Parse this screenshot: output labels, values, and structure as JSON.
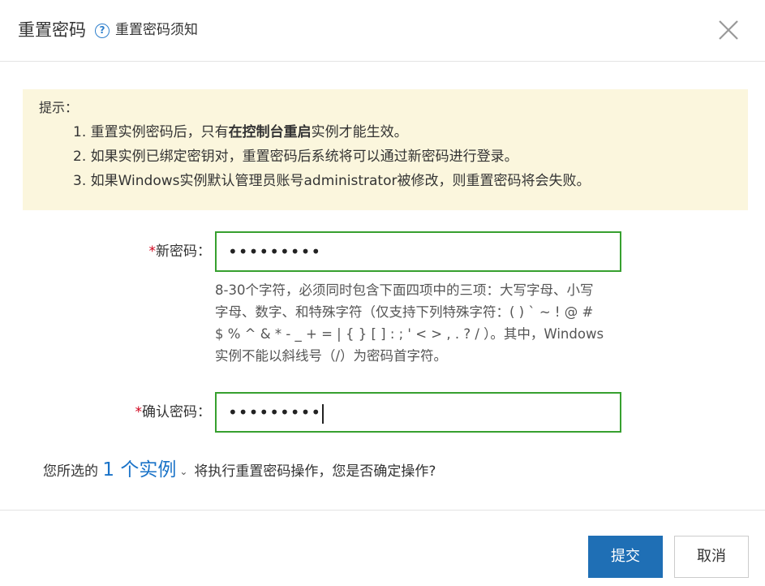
{
  "header": {
    "title": "重置密码",
    "help_link": "重置密码须知"
  },
  "notice": {
    "label": "提示：",
    "items": [
      {
        "prefix": "1. 重置实例密码后，只有",
        "bold": "在控制台重启",
        "suffix": "实例才能生效。"
      },
      {
        "text": "2. 如果实例已绑定密钥对，重置密码后系统将可以通过新密码进行登录。"
      },
      {
        "text": "3. 如果Windows实例默认管理员账号administrator被修改，则重置密码将会失败。"
      }
    ]
  },
  "form": {
    "required_mark": "*",
    "new_password": {
      "label": "新密码：",
      "value": "•••••••••"
    },
    "hint": "8-30个字符，必须同时包含下面四项中的三项：大写字母、小写字母、数字、和特殊字符（仅支持下列特殊字符：( ) ` ~ ! @ # $ % ^ & * - _ + = | { } [ ] : ; ' < > , . ? / ）。其中，Windows 实例不能以斜线号（/）为密码首字符。",
    "confirm_password": {
      "label": "确认密码：",
      "value": "•••••••••"
    }
  },
  "summary": {
    "prefix": "您所选的",
    "instance_link": "1 个实例",
    "suffix": "将执行重置密码操作，您是否确定操作?"
  },
  "footer": {
    "submit_label": "提交",
    "cancel_label": "取消"
  },
  "colors": {
    "accent": "#1f6fb5",
    "link": "#1a73c8",
    "input_border_valid": "#37a02f",
    "notice_bg": "#fbf6dd",
    "required": "#d0021b"
  }
}
